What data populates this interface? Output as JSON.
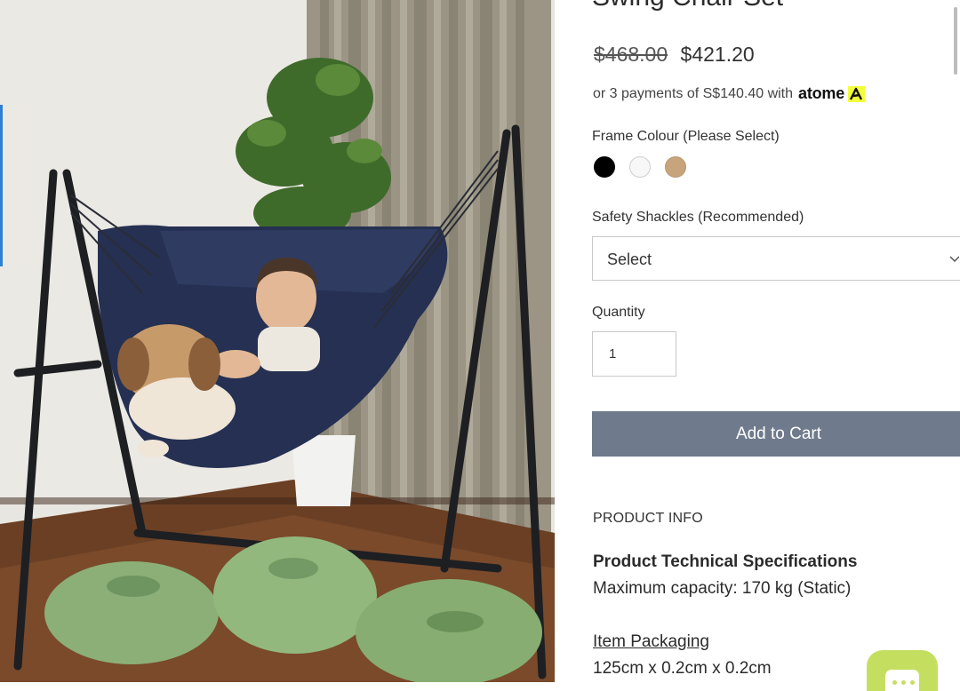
{
  "product": {
    "title": "Swing Chair Set",
    "old_price": "$468.00",
    "new_price": "$421.20",
    "installment_text": "or 3 payments of S$140.40 with",
    "installment_brand": "atome"
  },
  "options": {
    "frame_colour_label": "Frame Colour (Please Select)",
    "frame_colours": [
      {
        "name": "Black",
        "color": "#000000"
      },
      {
        "name": "White",
        "color": "#f7f7f7"
      },
      {
        "name": "Tan",
        "color": "#c8a47c"
      }
    ],
    "shackles_label": "Safety Shackles (Recommended)",
    "shackles_value": "Select",
    "quantity_label": "Quantity",
    "quantity_value": "1"
  },
  "cart": {
    "add_label": "Add to Cart",
    "button_color": "#6f7b8c"
  },
  "info": {
    "section_heading": "PRODUCT INFO",
    "spec_title": "Product Technical Specifications",
    "capacity": "Maximum capacity: 170 kg (Static)",
    "packaging_label": "Item Packaging ",
    "packaging_size": "125cm x 0.2cm x 0.2cm"
  },
  "chat": {
    "icon": "chat-icon",
    "color": "#c4df60"
  }
}
